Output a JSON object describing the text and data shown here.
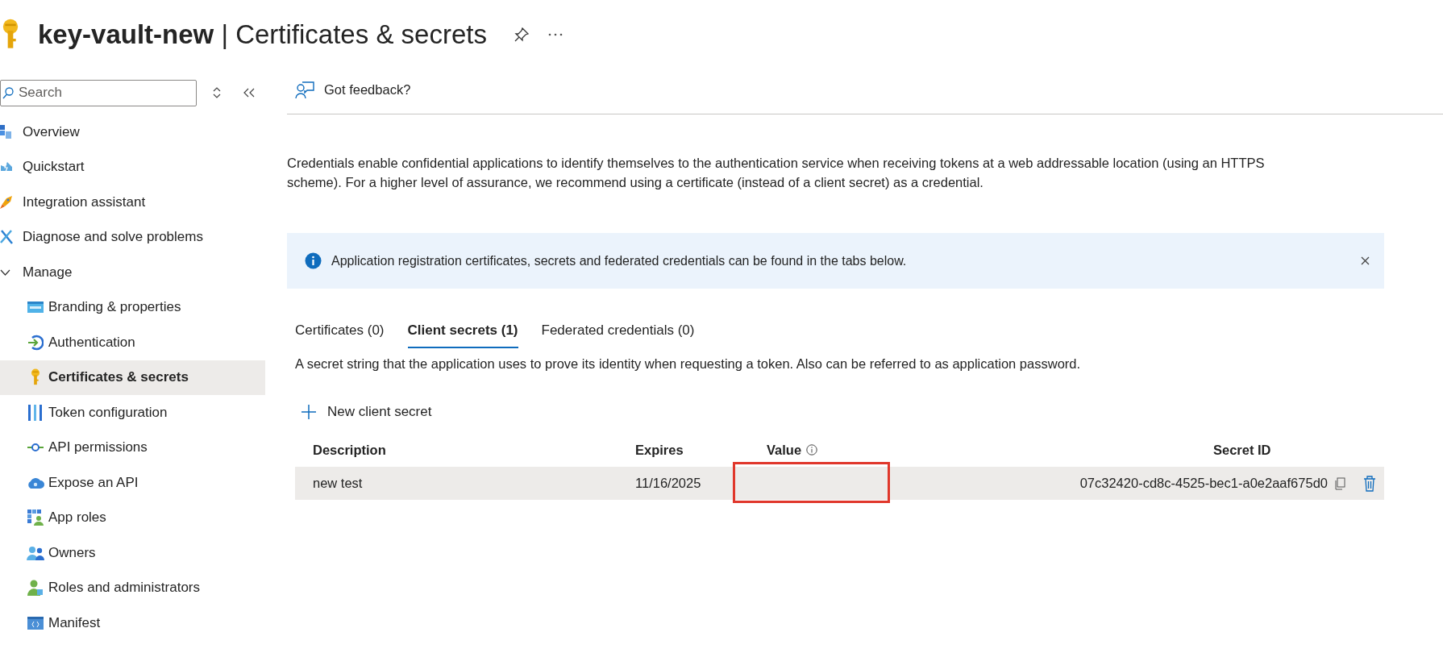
{
  "header": {
    "title": "**key-vault-new** | Certificates & secrets"
  },
  "sidebar": {
    "search": {
      "placeholder": "Search"
    },
    "items": [
      {
        "kind": "item",
        "label": "Overview",
        "selected": false
      },
      {
        "kind": "item",
        "label": "Quickstart",
        "selected": false
      },
      {
        "kind": "item",
        "label": "Integration assistant",
        "selected": false
      },
      {
        "kind": "item",
        "label": "Diagnose and solve problems",
        "selected": false
      },
      {
        "kind": "group",
        "label": "Manage",
        "selected": false,
        "expanded": true,
        "children": [
          {
            "label": "Branding & properties",
            "selected": false
          },
          {
            "label": "Authentication",
            "selected": false
          },
          {
            "label": "Certificates & secrets",
            "selected": true
          },
          {
            "label": "Token configuration",
            "selected": false
          },
          {
            "label": "API permissions",
            "selected": false
          },
          {
            "label": "Expose an API",
            "selected": false
          },
          {
            "label": "App roles",
            "selected": false
          },
          {
            "label": "Owners",
            "selected": false
          },
          {
            "label": "Roles and administrators",
            "selected": false
          },
          {
            "label": "Manifest",
            "selected": false
          }
        ]
      }
    ]
  },
  "toolbar": {
    "feedback": "Got feedback?"
  },
  "intro": "Credentials enable confidential applications to identify themselves to the authentication service when receiving tokens at a web addressable location (using an HTTPS scheme). For a higher level of assurance, we recommend using a certificate (instead of a client secret) as a credential.",
  "info_banner": {
    "text": "Application registration certificates, secrets and federated credentials can be found in the tabs below."
  },
  "tabs": [
    {
      "label": "Certificates (0)",
      "selected": false
    },
    {
      "label": "Client secrets (1)",
      "selected": true
    },
    {
      "label": "Federated credentials (0)",
      "selected": false
    }
  ],
  "tab_description": "A secret string that the application uses to prove its identity when requesting a token. Also can be referred to as application password.",
  "new_button": "New client secret",
  "table": {
    "columns": [
      "Description",
      "Expires",
      "Value",
      "Secret ID"
    ],
    "rows": [
      {
        "description": "new test",
        "expires": "11/16/2025",
        "value_highlighted": true,
        "secret_id": "07c32420-cd8c-4525-bec1-a0e2aaf675d0",
        "selected": true
      }
    ]
  }
}
